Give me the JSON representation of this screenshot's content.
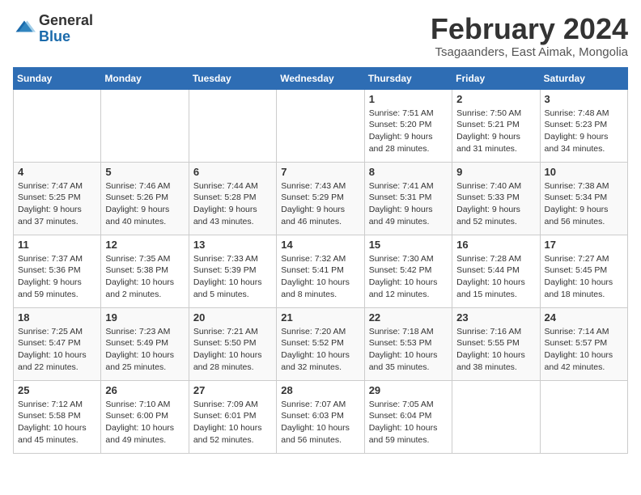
{
  "header": {
    "logo_line1": "General",
    "logo_line2": "Blue",
    "title": "February 2024",
    "subtitle": "Tsagaanders, East Aimak, Mongolia"
  },
  "weekdays": [
    "Sunday",
    "Monday",
    "Tuesday",
    "Wednesday",
    "Thursday",
    "Friday",
    "Saturday"
  ],
  "weeks": [
    [
      {
        "day": "",
        "detail": ""
      },
      {
        "day": "",
        "detail": ""
      },
      {
        "day": "",
        "detail": ""
      },
      {
        "day": "",
        "detail": ""
      },
      {
        "day": "1",
        "detail": "Sunrise: 7:51 AM\nSunset: 5:20 PM\nDaylight: 9 hours\nand 28 minutes."
      },
      {
        "day": "2",
        "detail": "Sunrise: 7:50 AM\nSunset: 5:21 PM\nDaylight: 9 hours\nand 31 minutes."
      },
      {
        "day": "3",
        "detail": "Sunrise: 7:48 AM\nSunset: 5:23 PM\nDaylight: 9 hours\nand 34 minutes."
      }
    ],
    [
      {
        "day": "4",
        "detail": "Sunrise: 7:47 AM\nSunset: 5:25 PM\nDaylight: 9 hours\nand 37 minutes."
      },
      {
        "day": "5",
        "detail": "Sunrise: 7:46 AM\nSunset: 5:26 PM\nDaylight: 9 hours\nand 40 minutes."
      },
      {
        "day": "6",
        "detail": "Sunrise: 7:44 AM\nSunset: 5:28 PM\nDaylight: 9 hours\nand 43 minutes."
      },
      {
        "day": "7",
        "detail": "Sunrise: 7:43 AM\nSunset: 5:29 PM\nDaylight: 9 hours\nand 46 minutes."
      },
      {
        "day": "8",
        "detail": "Sunrise: 7:41 AM\nSunset: 5:31 PM\nDaylight: 9 hours\nand 49 minutes."
      },
      {
        "day": "9",
        "detail": "Sunrise: 7:40 AM\nSunset: 5:33 PM\nDaylight: 9 hours\nand 52 minutes."
      },
      {
        "day": "10",
        "detail": "Sunrise: 7:38 AM\nSunset: 5:34 PM\nDaylight: 9 hours\nand 56 minutes."
      }
    ],
    [
      {
        "day": "11",
        "detail": "Sunrise: 7:37 AM\nSunset: 5:36 PM\nDaylight: 9 hours\nand 59 minutes."
      },
      {
        "day": "12",
        "detail": "Sunrise: 7:35 AM\nSunset: 5:38 PM\nDaylight: 10 hours\nand 2 minutes."
      },
      {
        "day": "13",
        "detail": "Sunrise: 7:33 AM\nSunset: 5:39 PM\nDaylight: 10 hours\nand 5 minutes."
      },
      {
        "day": "14",
        "detail": "Sunrise: 7:32 AM\nSunset: 5:41 PM\nDaylight: 10 hours\nand 8 minutes."
      },
      {
        "day": "15",
        "detail": "Sunrise: 7:30 AM\nSunset: 5:42 PM\nDaylight: 10 hours\nand 12 minutes."
      },
      {
        "day": "16",
        "detail": "Sunrise: 7:28 AM\nSunset: 5:44 PM\nDaylight: 10 hours\nand 15 minutes."
      },
      {
        "day": "17",
        "detail": "Sunrise: 7:27 AM\nSunset: 5:45 PM\nDaylight: 10 hours\nand 18 minutes."
      }
    ],
    [
      {
        "day": "18",
        "detail": "Sunrise: 7:25 AM\nSunset: 5:47 PM\nDaylight: 10 hours\nand 22 minutes."
      },
      {
        "day": "19",
        "detail": "Sunrise: 7:23 AM\nSunset: 5:49 PM\nDaylight: 10 hours\nand 25 minutes."
      },
      {
        "day": "20",
        "detail": "Sunrise: 7:21 AM\nSunset: 5:50 PM\nDaylight: 10 hours\nand 28 minutes."
      },
      {
        "day": "21",
        "detail": "Sunrise: 7:20 AM\nSunset: 5:52 PM\nDaylight: 10 hours\nand 32 minutes."
      },
      {
        "day": "22",
        "detail": "Sunrise: 7:18 AM\nSunset: 5:53 PM\nDaylight: 10 hours\nand 35 minutes."
      },
      {
        "day": "23",
        "detail": "Sunrise: 7:16 AM\nSunset: 5:55 PM\nDaylight: 10 hours\nand 38 minutes."
      },
      {
        "day": "24",
        "detail": "Sunrise: 7:14 AM\nSunset: 5:57 PM\nDaylight: 10 hours\nand 42 minutes."
      }
    ],
    [
      {
        "day": "25",
        "detail": "Sunrise: 7:12 AM\nSunset: 5:58 PM\nDaylight: 10 hours\nand 45 minutes."
      },
      {
        "day": "26",
        "detail": "Sunrise: 7:10 AM\nSunset: 6:00 PM\nDaylight: 10 hours\nand 49 minutes."
      },
      {
        "day": "27",
        "detail": "Sunrise: 7:09 AM\nSunset: 6:01 PM\nDaylight: 10 hours\nand 52 minutes."
      },
      {
        "day": "28",
        "detail": "Sunrise: 7:07 AM\nSunset: 6:03 PM\nDaylight: 10 hours\nand 56 minutes."
      },
      {
        "day": "29",
        "detail": "Sunrise: 7:05 AM\nSunset: 6:04 PM\nDaylight: 10 hours\nand 59 minutes."
      },
      {
        "day": "",
        "detail": ""
      },
      {
        "day": "",
        "detail": ""
      }
    ]
  ]
}
